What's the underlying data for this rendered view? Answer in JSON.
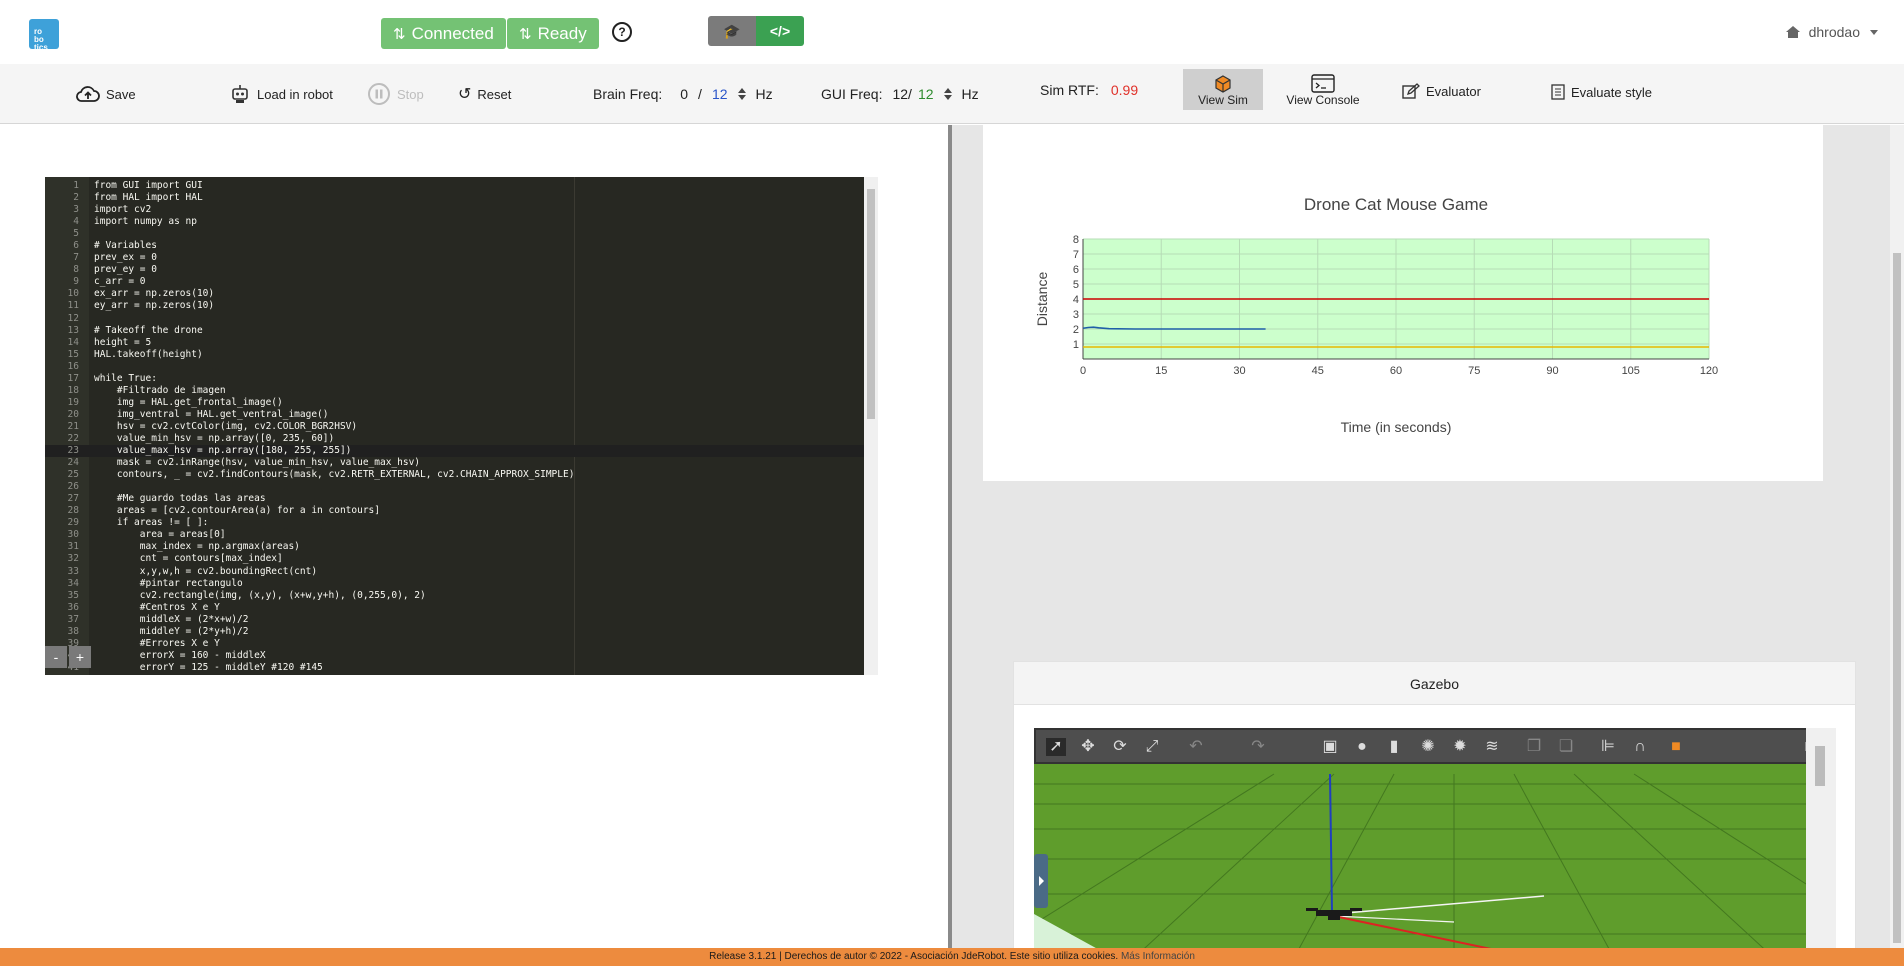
{
  "nav": {
    "logo_lines": [
      "ro",
      "bo",
      "tics"
    ],
    "connected_label": "Connected",
    "ready_label": "Ready",
    "help_glyph": "?",
    "username": "dhrodao",
    "colors": {
      "status_green": "#5cb85c",
      "mode_code": "#3ba152",
      "mode_edu": "#7b7b7b",
      "logo_blue": "#3ea1d9"
    }
  },
  "toolbar": {
    "save": "Save",
    "load": "Load in robot",
    "stop": "Stop",
    "reset": "Reset",
    "brain_freq_label": "Brain Freq:",
    "brain_freq_current": "0",
    "brain_freq_sep": "/",
    "brain_freq_target": "12",
    "brain_freq_unit": "Hz",
    "gui_freq_label": "GUI Freq:",
    "gui_freq_current": "12/",
    "gui_freq_target": "12",
    "gui_freq_unit": "Hz",
    "sim_rtf_label": "Sim RTF:",
    "sim_rtf_value": "0.99",
    "view_sim": "View Sim",
    "view_console": "View Console",
    "evaluator": "Evaluator",
    "evaluate_style": "Evaluate style"
  },
  "editor": {
    "active_line": 23,
    "lines": [
      "from GUI import GUI",
      "from HAL import HAL",
      "import cv2",
      "import numpy as np",
      "",
      "# Variables",
      "prev_ex = 0",
      "prev_ey = 0",
      "c_arr = 0",
      "ex_arr = np.zeros(10)",
      "ey_arr = np.zeros(10)",
      "",
      "# Takeoff the drone",
      "height = 5",
      "HAL.takeoff(height)",
      "",
      "while True:",
      "    #Filtrado de imagen",
      "    img = HAL.get_frontal_image()",
      "    img_ventral = HAL.get_ventral_image()",
      "    hsv = cv2.cvtColor(img, cv2.COLOR_BGR2HSV)",
      "    value_min_hsv = np.array([0, 235, 60])",
      "    value_max_hsv = np.array([180, 255, 255])",
      "    mask = cv2.inRange(hsv, value_min_hsv, value_max_hsv)",
      "    contours, _ = cv2.findContours(mask, cv2.RETR_EXTERNAL, cv2.CHAIN_APPROX_SIMPLE)",
      "",
      "    #Me guardo todas las areas",
      "    areas = [cv2.contourArea(a) for a in contours]",
      "    if areas != [ ]:",
      "        area = areas[0]",
      "        max_index = np.argmax(areas)",
      "        cnt = contours[max_index]",
      "        x,y,w,h = cv2.boundingRect(cnt)",
      "        #pintar rectangulo",
      "        cv2.rectangle(img, (x,y), (x+w,y+h), (0,255,0), 2)",
      "        #Centros X e Y",
      "        middleX = (2*x+w)/2",
      "        middleY = (2*y+h)/2",
      "        #Errores X e Y",
      "        errorX = 160 - middleX",
      "        errorY = 125 - middleY #120 #145"
    ],
    "font_minus": "-",
    "font_plus": "+"
  },
  "chart_data": {
    "type": "line",
    "title": "Drone Cat Mouse Game",
    "xlabel": "Time (in seconds)",
    "ylabel": "Distance",
    "xlim": [
      0,
      120
    ],
    "ylim": [
      0,
      8
    ],
    "xticks": [
      0,
      15,
      30,
      45,
      60,
      75,
      90,
      105,
      120
    ],
    "yticks": [
      1,
      2,
      3,
      4,
      5,
      6,
      7,
      8
    ],
    "grid": true,
    "background": "#ccffcc",
    "series": [
      {
        "color": "#cc0000",
        "x": [
          0,
          120
        ],
        "y": [
          4,
          4
        ]
      },
      {
        "color": "#1f5fa8",
        "x": [
          0,
          1,
          2,
          3,
          5,
          10,
          20,
          30,
          35
        ],
        "y": [
          2.05,
          2.1,
          2.12,
          2.08,
          2.02,
          2.0,
          2.0,
          2.0,
          2.0
        ]
      },
      {
        "color": "#e6b800",
        "x": [
          0,
          120
        ],
        "y": [
          0.8,
          0.8
        ]
      }
    ]
  },
  "gazebo": {
    "title": "Gazebo",
    "sky_color": "#d8f2d8",
    "ground_color": "#5f9d2c"
  },
  "footer": {
    "text": "Release 3.1.21 | Derechos de autor © 2022 - Asociación JdeRobot. Este sitio utiliza cookies.",
    "more": "Más Información"
  }
}
